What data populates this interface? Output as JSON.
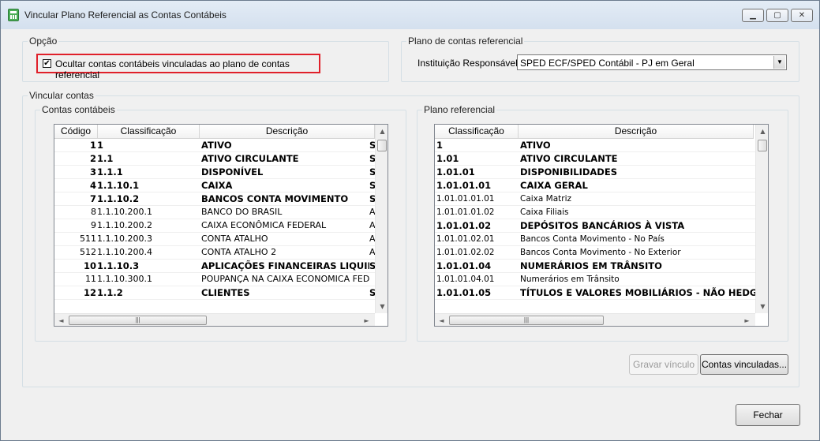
{
  "window": {
    "title": "Vincular Plano Referencial as Contas Contábeis",
    "controls": {
      "minimize": "▁",
      "maximize": "▢",
      "close": "✕"
    }
  },
  "opcao": {
    "legend": "Opção",
    "checkbox_checked": true,
    "checkbox_mark": "✔",
    "checkbox_label": "Ocultar contas contábeis vinculadas ao plano de contas referencial"
  },
  "plano_contas_referencial": {
    "legend": "Plano de contas referencial",
    "label": "Instituição Responsável:",
    "selected": "SPED ECF/SPED Contábil - PJ em Geral",
    "arrow": "▼"
  },
  "vincular": {
    "legend": "Vincular contas",
    "contas_contabeis": {
      "legend": "Contas contábeis",
      "columns": [
        "Código",
        "Classificação",
        "Descrição"
      ],
      "rows": [
        {
          "codigo": "1",
          "classificacao": "1",
          "descricao": "ATIVO",
          "extra": "S",
          "bold": true
        },
        {
          "codigo": "2",
          "classificacao": "1.1",
          "descricao": "ATIVO CIRCULANTE",
          "extra": "S",
          "bold": true
        },
        {
          "codigo": "3",
          "classificacao": "1.1.1",
          "descricao": "DISPONÍVEL",
          "extra": "S",
          "bold": true
        },
        {
          "codigo": "4",
          "classificacao": "1.1.10.1",
          "descricao": "CAIXA",
          "extra": "S",
          "bold": true
        },
        {
          "codigo": "7",
          "classificacao": "1.1.10.2",
          "descricao": "BANCOS CONTA MOVIMENTO",
          "extra": "S",
          "bold": true
        },
        {
          "codigo": "8",
          "classificacao": "1.1.10.200.1",
          "descricao": "BANCO DO BRASIL",
          "extra": "A",
          "bold": false
        },
        {
          "codigo": "9",
          "classificacao": "1.1.10.200.2",
          "descricao": "CAIXA ECONÔMICA FEDERAL",
          "extra": "A",
          "bold": false
        },
        {
          "codigo": "511",
          "classificacao": "1.1.10.200.3",
          "descricao": "CONTA ATALHO",
          "extra": "A",
          "bold": false
        },
        {
          "codigo": "512",
          "classificacao": "1.1.10.200.4",
          "descricao": "CONTA ATALHO 2",
          "extra": "A",
          "bold": false
        },
        {
          "codigo": "10",
          "classificacao": "1.1.10.3",
          "descricao": "APLICAÇÕES FINANCEIRAS LIQUIDE",
          "extra": "S",
          "bold": true
        },
        {
          "codigo": "11",
          "classificacao": "1.1.10.300.1",
          "descricao": "POUPANÇA NA CAIXA ECONOMICA FEDERA",
          "extra": "",
          "bold": false
        },
        {
          "codigo": "12",
          "classificacao": "1.1.2",
          "descricao": "CLIENTES",
          "extra": "S",
          "bold": true
        }
      ],
      "hscroll_grip": "|||"
    },
    "plano_referencial": {
      "legend": "Plano referencial",
      "columns": [
        "Classificação",
        "Descrição"
      ],
      "rows": [
        {
          "classificacao": "1",
          "descricao": "ATIVO",
          "bold": true
        },
        {
          "classificacao": "1.01",
          "descricao": "ATIVO CIRCULANTE",
          "bold": true
        },
        {
          "classificacao": "1.01.01",
          "descricao": "DISPONIBILIDADES",
          "bold": true
        },
        {
          "classificacao": "1.01.01.01",
          "descricao": "CAIXA GERAL",
          "bold": true
        },
        {
          "classificacao": "1.01.01.01.01",
          "descricao": "Caixa Matriz",
          "bold": false
        },
        {
          "classificacao": "1.01.01.01.02",
          "descricao": "Caixa Filiais",
          "bold": false
        },
        {
          "classificacao": "1.01.01.02",
          "descricao": "DEPÓSITOS BANCÁRIOS À VISTA",
          "bold": true
        },
        {
          "classificacao": "1.01.01.02.01",
          "descricao": "Bancos Conta Movimento - No País",
          "bold": false
        },
        {
          "classificacao": "1.01.01.02.02",
          "descricao": "Bancos Conta Movimento - No Exterior",
          "bold": false
        },
        {
          "classificacao": "1.01.01.04",
          "descricao": "NUMERÁRIOS EM TRÂNSITO",
          "bold": true
        },
        {
          "classificacao": "1.01.01.04.01",
          "descricao": "Numerários em Trânsito",
          "bold": false
        },
        {
          "classificacao": "1.01.01.05",
          "descricao": "TÍTULOS E VALORES MOBILIÁRIOS - NÃO HEDGE",
          "bold": true
        }
      ],
      "hscroll_grip": "|||"
    },
    "buttons": {
      "gravar": "Gravar vínculo",
      "contas_vinculadas": "Contas vinculadas..."
    }
  },
  "footer": {
    "fechar": "Fechar"
  },
  "scroll_arrows": {
    "up": "▲",
    "down": "▼",
    "left": "◄",
    "right": "►"
  }
}
